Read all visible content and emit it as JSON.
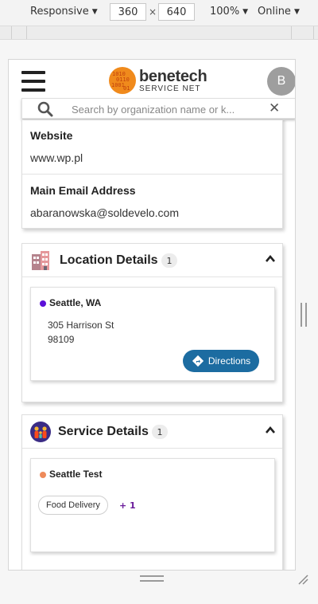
{
  "devtools": {
    "device": "Responsive",
    "width": "360",
    "times": "×",
    "height": "640",
    "zoom": "100%",
    "network": "Online"
  },
  "header": {
    "logo_name": "benetech",
    "logo_sub": "SERVICE NET",
    "avatar_initial": "B"
  },
  "search": {
    "placeholder": "Search by organization name or k..."
  },
  "contact": {
    "website_label": "Website",
    "website_value": "www.wp.pl",
    "email_label": "Main Email Address",
    "email_value": "abaranowska@soldevelo.com"
  },
  "location": {
    "title": "Location Details",
    "count": "1",
    "name": "Seattle, WA",
    "address_line1": "305 Harrison St",
    "address_line2": "98109",
    "directions_label": "Directions",
    "dot_color": "#5b0fd8"
  },
  "service": {
    "title": "Service Details",
    "count": "1",
    "name": "Seattle Test",
    "tag": "Food Delivery",
    "more": "+ 1",
    "dot_color": "#ee8a5a"
  },
  "colors": {
    "accent_button": "#1c6ca1",
    "logo_orange": "#f08a1c"
  }
}
